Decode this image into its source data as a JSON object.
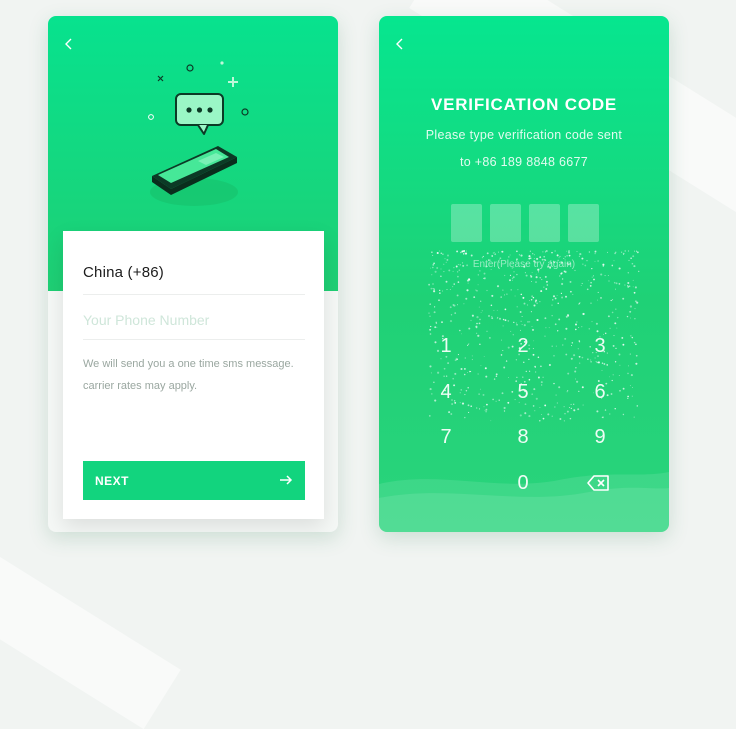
{
  "colors": {
    "accent": "#12d47e",
    "gradient_top": "#06e68f",
    "gradient_bottom": "#2ad47c",
    "placeholder": "#cfe6da",
    "hint_text": "#9aa7a0"
  },
  "screen_login": {
    "back_icon": "chevron-left-icon",
    "country_code": "China (+86)",
    "phone_placeholder": "Your Phone Number",
    "hint_line1": "We will send you a one time sms message.",
    "hint_line2": "carrier rates may apply.",
    "next_label": "NEXT",
    "next_icon": "arrow-right-icon"
  },
  "screen_verify": {
    "back_icon": "chevron-left-icon",
    "title": "VERIFICATION CODE",
    "subtitle_line1": "Please type verification code sent",
    "subtitle_line2": "to +86 189 8848 6677",
    "code_hint": "Enter(Please try again)",
    "keys": [
      "1",
      "2",
      "3",
      "4",
      "5",
      "6",
      "7",
      "8",
      "9",
      "0"
    ],
    "delete_icon": "backspace-icon"
  }
}
